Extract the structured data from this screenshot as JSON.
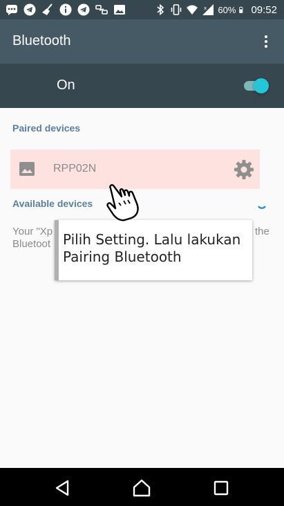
{
  "status_bar": {
    "left_icons": [
      "messages-icon",
      "telegram-icon",
      "broom-icon",
      "info-icon",
      "telegram-icon",
      "link-icon",
      "image-icon"
    ],
    "right_icons": [
      "bluetooth-icon",
      "vibrate-icon",
      "wifi-icon",
      "signal-icon",
      "battery-icon"
    ],
    "battery": "60%",
    "time": "09:52"
  },
  "app_bar": {
    "title": "Bluetooth",
    "menu_icon": "more-vert-icon"
  },
  "bluetooth_toggle": {
    "label": "On",
    "enabled": true
  },
  "paired": {
    "header": "Paired devices",
    "devices": [
      {
        "name": "RPP02N",
        "icon": "image-icon",
        "settings_icon": "gear-icon"
      }
    ]
  },
  "available": {
    "header": "Available devices",
    "description_fragments": [
      "Your \"Xp",
      "Bluetoot",
      "the"
    ]
  },
  "tooltip": {
    "text": "Pilih Setting. Lalu lakukan Pairing Bluetooth"
  },
  "nav_bar": {
    "back_icon": "back-icon",
    "home_icon": "home-icon",
    "recents_icon": "recents-icon"
  },
  "colors": {
    "status_bar": "#37474f",
    "app_bar": "#455a64",
    "accent": "#26c6da",
    "section_header": "#5a7fa0",
    "highlight": "#fde2e0"
  }
}
